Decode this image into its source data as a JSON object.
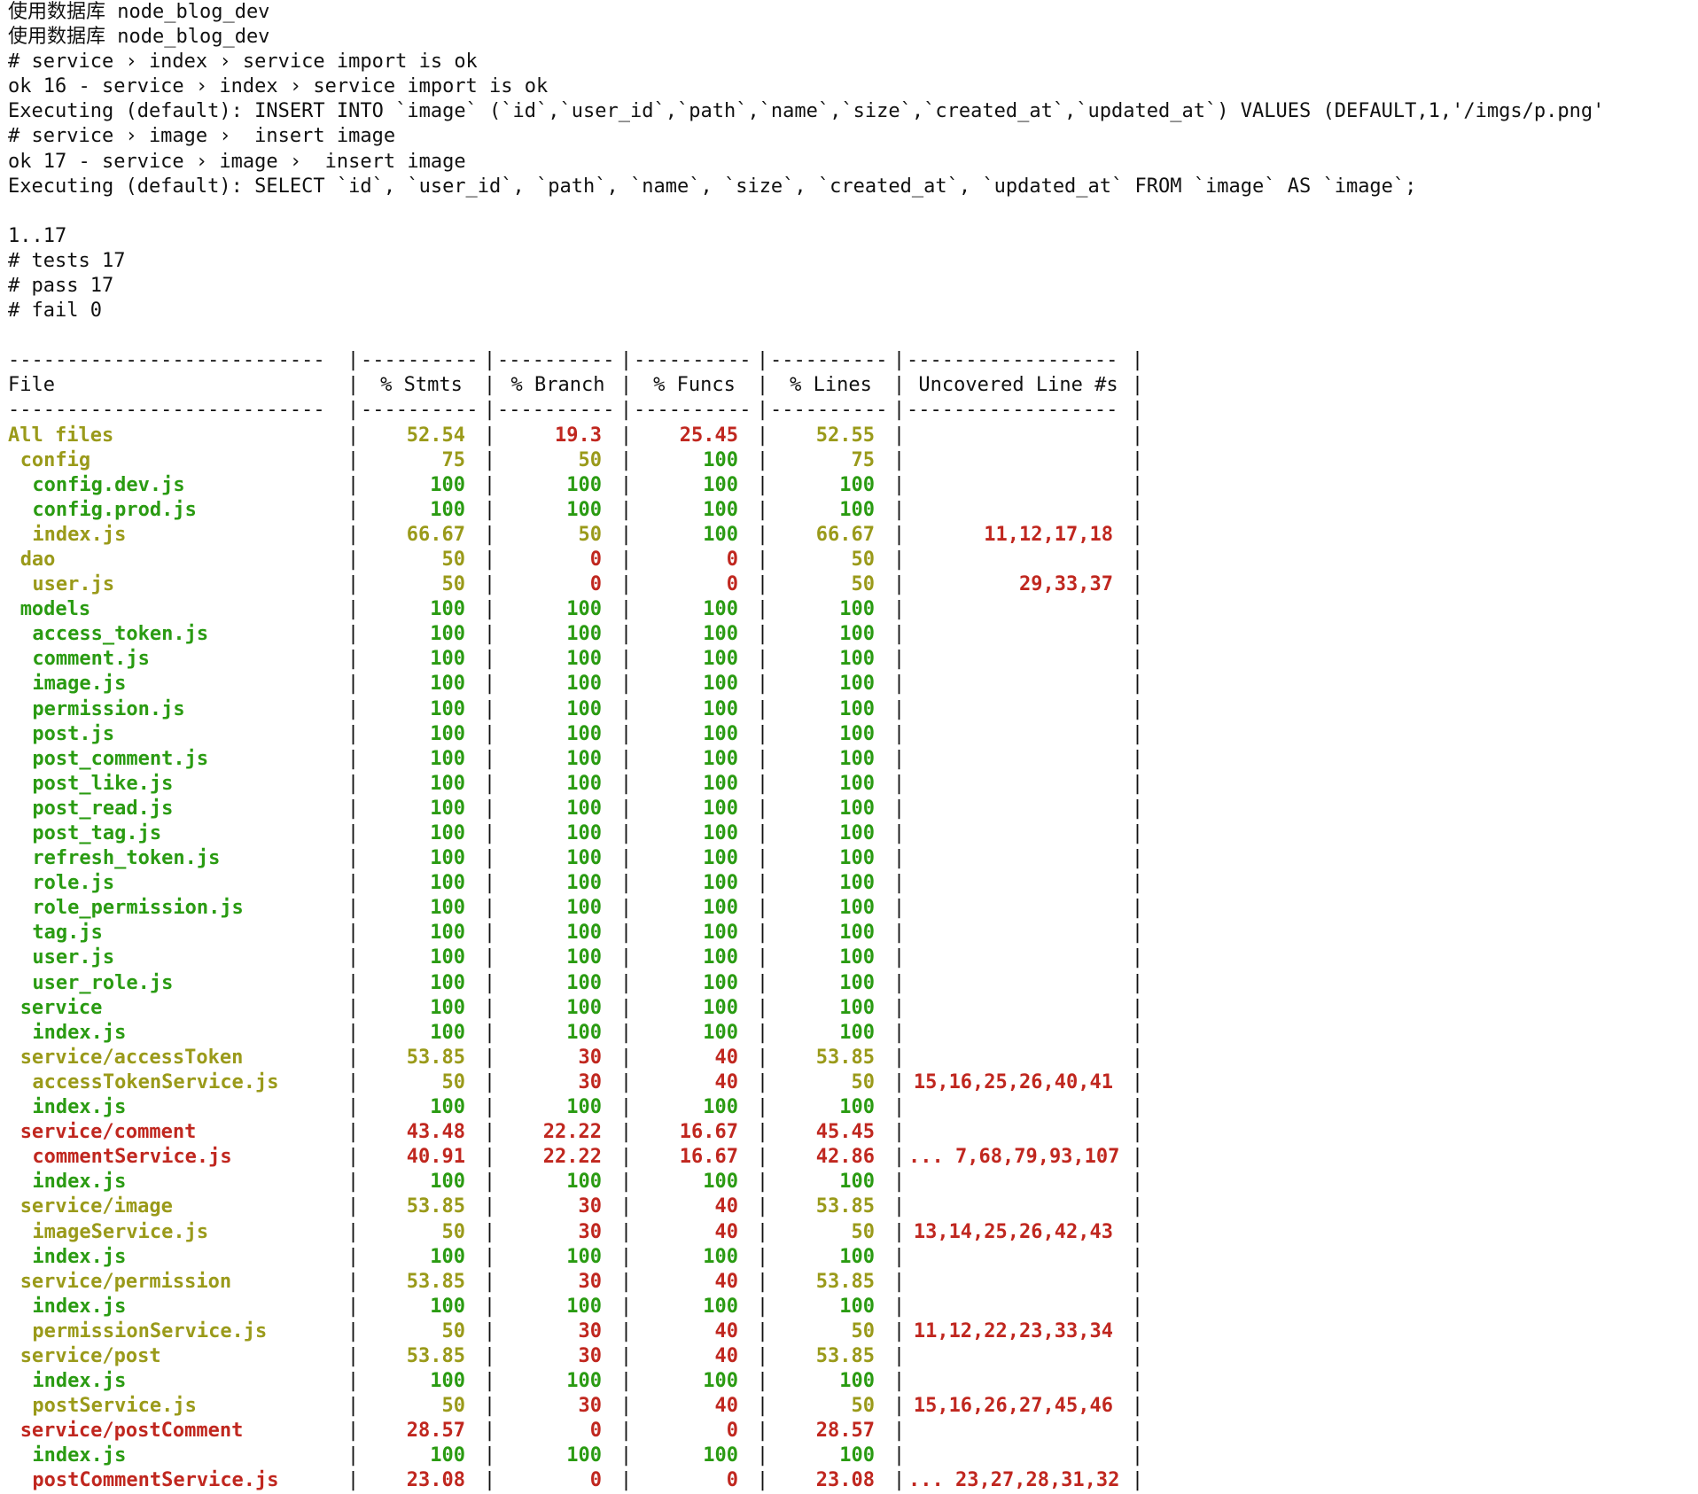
{
  "log_lines": [
    "使用数据库 node_blog_dev",
    "使用数据库 node_blog_dev",
    "# service › index › service import is ok",
    "ok 16 - service › index › service import is ok",
    "Executing (default): INSERT INTO `image` (`id`,`user_id`,`path`,`name`,`size`,`created_at`,`updated_at`) VALUES (DEFAULT,1,'/imgs/p.png'",
    "# service › image ›  insert image",
    "ok 17 - service › image ›  insert image",
    "Executing (default): SELECT `id`, `user_id`, `path`, `name`, `size`, `created_at`, `updated_at` FROM `image` AS `image`;",
    "",
    "1..17",
    "# tests 17",
    "# pass 17",
    "# fail 0"
  ],
  "coverage": {
    "headers": [
      "File",
      "% Stmts",
      "% Branch",
      "% Funcs",
      "% Lines",
      "Uncovered Line #s"
    ],
    "dash_file": "---------------------------",
    "dash_num": "----------",
    "dash_unc": "------------------",
    "rows": [
      {
        "file": "All files",
        "indent": 0,
        "fc": "yellow",
        "stmts": "52.54",
        "sc": "yellow",
        "branch": "19.3",
        "bc": "red",
        "funcs": "25.45",
        "fuc": "red",
        "lines": "52.55",
        "lc": "yellow",
        "unc": ""
      },
      {
        "file": "config",
        "indent": 1,
        "fc": "yellow",
        "stmts": "75",
        "sc": "yellow",
        "branch": "50",
        "bc": "yellow",
        "funcs": "100",
        "fuc": "green",
        "lines": "75",
        "lc": "yellow",
        "unc": ""
      },
      {
        "file": "config.dev.js",
        "indent": 2,
        "fc": "green",
        "stmts": "100",
        "sc": "green",
        "branch": "100",
        "bc": "green",
        "funcs": "100",
        "fuc": "green",
        "lines": "100",
        "lc": "green",
        "unc": ""
      },
      {
        "file": "config.prod.js",
        "indent": 2,
        "fc": "green",
        "stmts": "100",
        "sc": "green",
        "branch": "100",
        "bc": "green",
        "funcs": "100",
        "fuc": "green",
        "lines": "100",
        "lc": "green",
        "unc": ""
      },
      {
        "file": "index.js",
        "indent": 2,
        "fc": "yellow",
        "stmts": "66.67",
        "sc": "yellow",
        "branch": "50",
        "bc": "yellow",
        "funcs": "100",
        "fuc": "green",
        "lines": "66.67",
        "lc": "yellow",
        "unc": "11,12,17,18"
      },
      {
        "file": "dao",
        "indent": 1,
        "fc": "yellow",
        "stmts": "50",
        "sc": "yellow",
        "branch": "0",
        "bc": "red",
        "funcs": "0",
        "fuc": "red",
        "lines": "50",
        "lc": "yellow",
        "unc": ""
      },
      {
        "file": "user.js",
        "indent": 2,
        "fc": "yellow",
        "stmts": "50",
        "sc": "yellow",
        "branch": "0",
        "bc": "red",
        "funcs": "0",
        "fuc": "red",
        "lines": "50",
        "lc": "yellow",
        "unc": "29,33,37"
      },
      {
        "file": "models",
        "indent": 1,
        "fc": "green",
        "stmts": "100",
        "sc": "green",
        "branch": "100",
        "bc": "green",
        "funcs": "100",
        "fuc": "green",
        "lines": "100",
        "lc": "green",
        "unc": ""
      },
      {
        "file": "access_token.js",
        "indent": 2,
        "fc": "green",
        "stmts": "100",
        "sc": "green",
        "branch": "100",
        "bc": "green",
        "funcs": "100",
        "fuc": "green",
        "lines": "100",
        "lc": "green",
        "unc": ""
      },
      {
        "file": "comment.js",
        "indent": 2,
        "fc": "green",
        "stmts": "100",
        "sc": "green",
        "branch": "100",
        "bc": "green",
        "funcs": "100",
        "fuc": "green",
        "lines": "100",
        "lc": "green",
        "unc": ""
      },
      {
        "file": "image.js",
        "indent": 2,
        "fc": "green",
        "stmts": "100",
        "sc": "green",
        "branch": "100",
        "bc": "green",
        "funcs": "100",
        "fuc": "green",
        "lines": "100",
        "lc": "green",
        "unc": ""
      },
      {
        "file": "permission.js",
        "indent": 2,
        "fc": "green",
        "stmts": "100",
        "sc": "green",
        "branch": "100",
        "bc": "green",
        "funcs": "100",
        "fuc": "green",
        "lines": "100",
        "lc": "green",
        "unc": ""
      },
      {
        "file": "post.js",
        "indent": 2,
        "fc": "green",
        "stmts": "100",
        "sc": "green",
        "branch": "100",
        "bc": "green",
        "funcs": "100",
        "fuc": "green",
        "lines": "100",
        "lc": "green",
        "unc": ""
      },
      {
        "file": "post_comment.js",
        "indent": 2,
        "fc": "green",
        "stmts": "100",
        "sc": "green",
        "branch": "100",
        "bc": "green",
        "funcs": "100",
        "fuc": "green",
        "lines": "100",
        "lc": "green",
        "unc": ""
      },
      {
        "file": "post_like.js",
        "indent": 2,
        "fc": "green",
        "stmts": "100",
        "sc": "green",
        "branch": "100",
        "bc": "green",
        "funcs": "100",
        "fuc": "green",
        "lines": "100",
        "lc": "green",
        "unc": ""
      },
      {
        "file": "post_read.js",
        "indent": 2,
        "fc": "green",
        "stmts": "100",
        "sc": "green",
        "branch": "100",
        "bc": "green",
        "funcs": "100",
        "fuc": "green",
        "lines": "100",
        "lc": "green",
        "unc": ""
      },
      {
        "file": "post_tag.js",
        "indent": 2,
        "fc": "green",
        "stmts": "100",
        "sc": "green",
        "branch": "100",
        "bc": "green",
        "funcs": "100",
        "fuc": "green",
        "lines": "100",
        "lc": "green",
        "unc": ""
      },
      {
        "file": "refresh_token.js",
        "indent": 2,
        "fc": "green",
        "stmts": "100",
        "sc": "green",
        "branch": "100",
        "bc": "green",
        "funcs": "100",
        "fuc": "green",
        "lines": "100",
        "lc": "green",
        "unc": ""
      },
      {
        "file": "role.js",
        "indent": 2,
        "fc": "green",
        "stmts": "100",
        "sc": "green",
        "branch": "100",
        "bc": "green",
        "funcs": "100",
        "fuc": "green",
        "lines": "100",
        "lc": "green",
        "unc": ""
      },
      {
        "file": "role_permission.js",
        "indent": 2,
        "fc": "green",
        "stmts": "100",
        "sc": "green",
        "branch": "100",
        "bc": "green",
        "funcs": "100",
        "fuc": "green",
        "lines": "100",
        "lc": "green",
        "unc": ""
      },
      {
        "file": "tag.js",
        "indent": 2,
        "fc": "green",
        "stmts": "100",
        "sc": "green",
        "branch": "100",
        "bc": "green",
        "funcs": "100",
        "fuc": "green",
        "lines": "100",
        "lc": "green",
        "unc": ""
      },
      {
        "file": "user.js",
        "indent": 2,
        "fc": "green",
        "stmts": "100",
        "sc": "green",
        "branch": "100",
        "bc": "green",
        "funcs": "100",
        "fuc": "green",
        "lines": "100",
        "lc": "green",
        "unc": ""
      },
      {
        "file": "user_role.js",
        "indent": 2,
        "fc": "green",
        "stmts": "100",
        "sc": "green",
        "branch": "100",
        "bc": "green",
        "funcs": "100",
        "fuc": "green",
        "lines": "100",
        "lc": "green",
        "unc": ""
      },
      {
        "file": "service",
        "indent": 1,
        "fc": "green",
        "stmts": "100",
        "sc": "green",
        "branch": "100",
        "bc": "green",
        "funcs": "100",
        "fuc": "green",
        "lines": "100",
        "lc": "green",
        "unc": ""
      },
      {
        "file": "index.js",
        "indent": 2,
        "fc": "green",
        "stmts": "100",
        "sc": "green",
        "branch": "100",
        "bc": "green",
        "funcs": "100",
        "fuc": "green",
        "lines": "100",
        "lc": "green",
        "unc": ""
      },
      {
        "file": "service/accessToken",
        "indent": 1,
        "fc": "yellow",
        "stmts": "53.85",
        "sc": "yellow",
        "branch": "30",
        "bc": "red",
        "funcs": "40",
        "fuc": "red",
        "lines": "53.85",
        "lc": "yellow",
        "unc": ""
      },
      {
        "file": "accessTokenService.js",
        "indent": 2,
        "fc": "yellow",
        "stmts": "50",
        "sc": "yellow",
        "branch": "30",
        "bc": "red",
        "funcs": "40",
        "fuc": "red",
        "lines": "50",
        "lc": "yellow",
        "unc": "15,16,25,26,40,41"
      },
      {
        "file": "index.js",
        "indent": 2,
        "fc": "green",
        "stmts": "100",
        "sc": "green",
        "branch": "100",
        "bc": "green",
        "funcs": "100",
        "fuc": "green",
        "lines": "100",
        "lc": "green",
        "unc": ""
      },
      {
        "file": "service/comment",
        "indent": 1,
        "fc": "red",
        "stmts": "43.48",
        "sc": "red",
        "branch": "22.22",
        "bc": "red",
        "funcs": "16.67",
        "fuc": "red",
        "lines": "45.45",
        "lc": "red",
        "unc": ""
      },
      {
        "file": "commentService.js",
        "indent": 2,
        "fc": "red",
        "stmts": "40.91",
        "sc": "red",
        "branch": "22.22",
        "bc": "red",
        "funcs": "16.67",
        "fuc": "red",
        "lines": "42.86",
        "lc": "red",
        "unc": "... 7,68,79,93,107"
      },
      {
        "file": "index.js",
        "indent": 2,
        "fc": "green",
        "stmts": "100",
        "sc": "green",
        "branch": "100",
        "bc": "green",
        "funcs": "100",
        "fuc": "green",
        "lines": "100",
        "lc": "green",
        "unc": ""
      },
      {
        "file": "service/image",
        "indent": 1,
        "fc": "yellow",
        "stmts": "53.85",
        "sc": "yellow",
        "branch": "30",
        "bc": "red",
        "funcs": "40",
        "fuc": "red",
        "lines": "53.85",
        "lc": "yellow",
        "unc": ""
      },
      {
        "file": "imageService.js",
        "indent": 2,
        "fc": "yellow",
        "stmts": "50",
        "sc": "yellow",
        "branch": "30",
        "bc": "red",
        "funcs": "40",
        "fuc": "red",
        "lines": "50",
        "lc": "yellow",
        "unc": "13,14,25,26,42,43"
      },
      {
        "file": "index.js",
        "indent": 2,
        "fc": "green",
        "stmts": "100",
        "sc": "green",
        "branch": "100",
        "bc": "green",
        "funcs": "100",
        "fuc": "green",
        "lines": "100",
        "lc": "green",
        "unc": ""
      },
      {
        "file": "service/permission",
        "indent": 1,
        "fc": "yellow",
        "stmts": "53.85",
        "sc": "yellow",
        "branch": "30",
        "bc": "red",
        "funcs": "40",
        "fuc": "red",
        "lines": "53.85",
        "lc": "yellow",
        "unc": ""
      },
      {
        "file": "index.js",
        "indent": 2,
        "fc": "green",
        "stmts": "100",
        "sc": "green",
        "branch": "100",
        "bc": "green",
        "funcs": "100",
        "fuc": "green",
        "lines": "100",
        "lc": "green",
        "unc": ""
      },
      {
        "file": "permissionService.js",
        "indent": 2,
        "fc": "yellow",
        "stmts": "50",
        "sc": "yellow",
        "branch": "30",
        "bc": "red",
        "funcs": "40",
        "fuc": "red",
        "lines": "50",
        "lc": "yellow",
        "unc": "11,12,22,23,33,34"
      },
      {
        "file": "service/post",
        "indent": 1,
        "fc": "yellow",
        "stmts": "53.85",
        "sc": "yellow",
        "branch": "30",
        "bc": "red",
        "funcs": "40",
        "fuc": "red",
        "lines": "53.85",
        "lc": "yellow",
        "unc": ""
      },
      {
        "file": "index.js",
        "indent": 2,
        "fc": "green",
        "stmts": "100",
        "sc": "green",
        "branch": "100",
        "bc": "green",
        "funcs": "100",
        "fuc": "green",
        "lines": "100",
        "lc": "green",
        "unc": ""
      },
      {
        "file": "postService.js",
        "indent": 2,
        "fc": "yellow",
        "stmts": "50",
        "sc": "yellow",
        "branch": "30",
        "bc": "red",
        "funcs": "40",
        "fuc": "red",
        "lines": "50",
        "lc": "yellow",
        "unc": "15,16,26,27,45,46"
      },
      {
        "file": "service/postComment",
        "indent": 1,
        "fc": "red",
        "stmts": "28.57",
        "sc": "red",
        "branch": "0",
        "bc": "red",
        "funcs": "0",
        "fuc": "red",
        "lines": "28.57",
        "lc": "red",
        "unc": ""
      },
      {
        "file": "index.js",
        "indent": 2,
        "fc": "green",
        "stmts": "100",
        "sc": "green",
        "branch": "100",
        "bc": "green",
        "funcs": "100",
        "fuc": "green",
        "lines": "100",
        "lc": "green",
        "unc": ""
      },
      {
        "file": "postCommentService.js",
        "indent": 2,
        "fc": "red",
        "stmts": "23.08",
        "sc": "red",
        "branch": "0",
        "bc": "red",
        "funcs": "0",
        "fuc": "red",
        "lines": "23.08",
        "lc": "red",
        "unc": "... 23,27,28,31,32"
      }
    ]
  },
  "colors": {
    "green": "#2a9b12",
    "yellow": "#9a9a1a",
    "red": "#c0271f",
    "text": "#111111",
    "background": "#ffffff"
  }
}
